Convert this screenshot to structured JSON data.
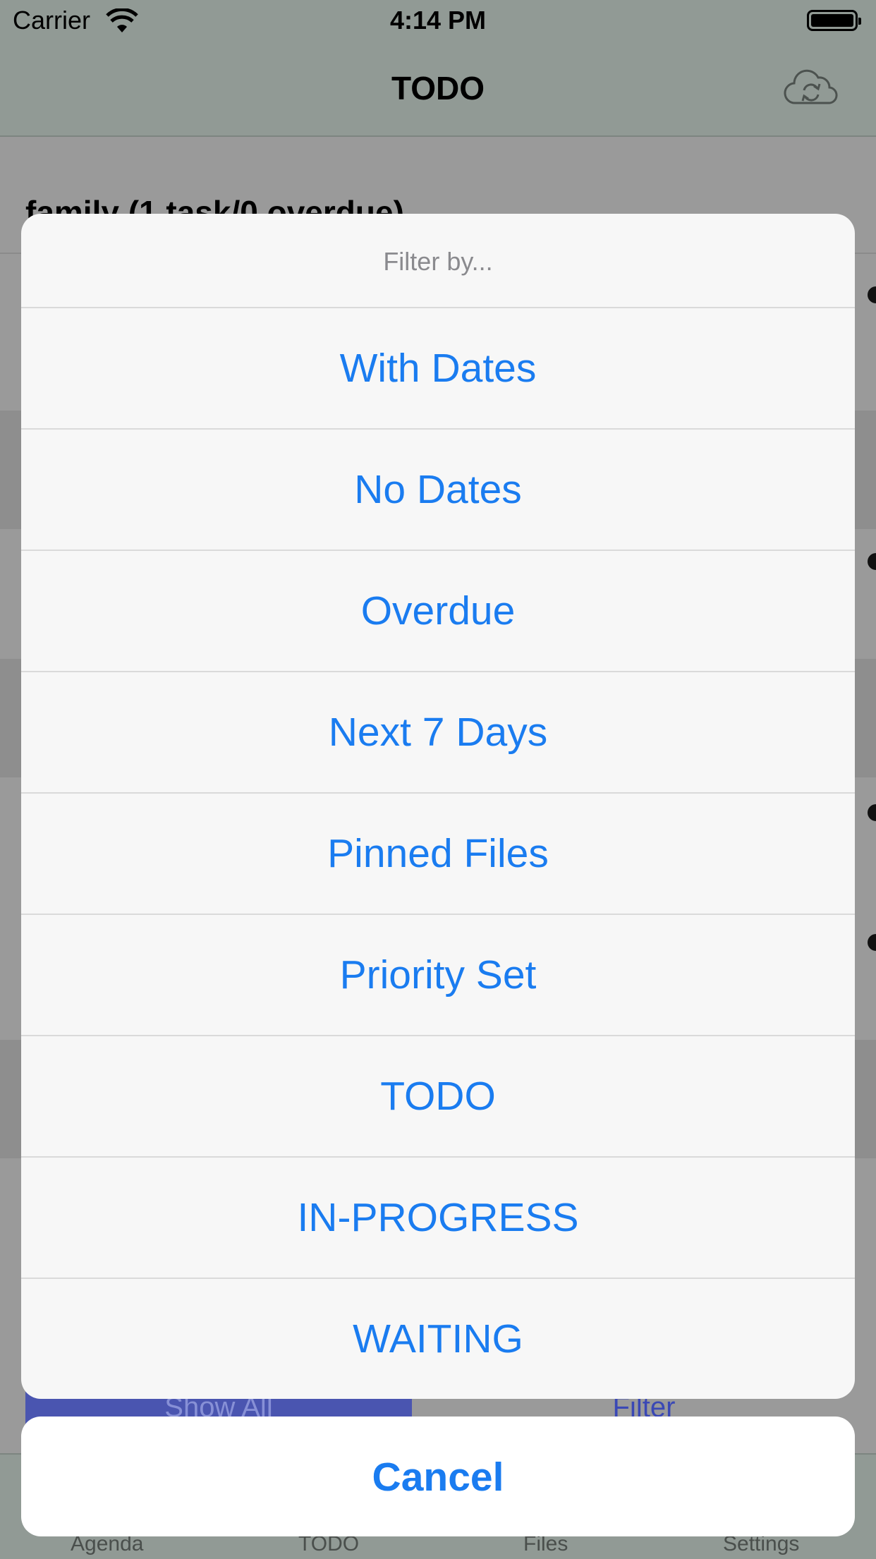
{
  "status_bar": {
    "carrier": "Carrier",
    "time": "4:14 PM"
  },
  "nav": {
    "title": "TODO",
    "sync_icon": "cloud-sync-icon"
  },
  "list": {
    "section_header": "family (1 task/0 overdue)"
  },
  "bottom_buttons": {
    "show_all": "Show All",
    "filter": "Filter"
  },
  "tabs": [
    "Agenda",
    "TODO",
    "Files",
    "Settings"
  ],
  "action_sheet": {
    "title": "Filter by...",
    "options": [
      "With Dates",
      "No Dates",
      "Overdue",
      "Next 7 Days",
      "Pinned Files",
      "Priority Set",
      "TODO",
      "IN-PROGRESS",
      "WAITING"
    ],
    "cancel": "Cancel"
  },
  "colors": {
    "accent": "#1a7cf0",
    "show_all_bg": "#4a55b0"
  }
}
